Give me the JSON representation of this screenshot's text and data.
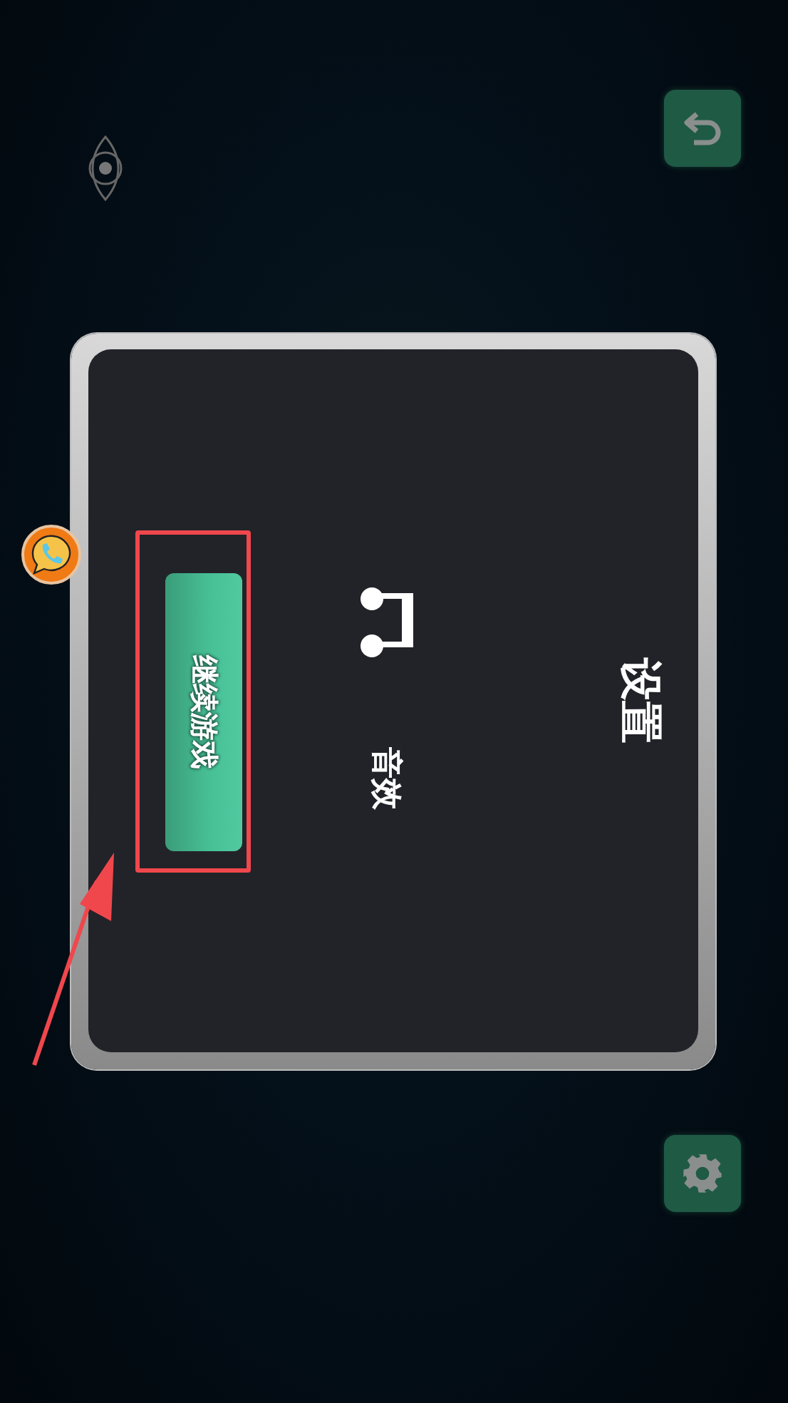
{
  "dialog": {
    "title": "设置",
    "sound_label": "音效",
    "continue_button": "继续游戏"
  }
}
